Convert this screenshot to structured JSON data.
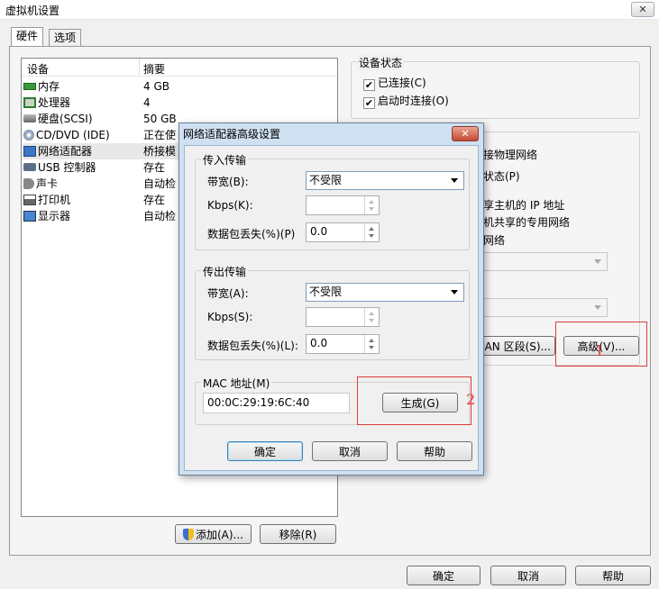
{
  "window": {
    "title": "虚拟机设置",
    "close": "✕"
  },
  "tabs": {
    "hardware": "硬件",
    "options": "选项"
  },
  "device_list": {
    "headers": {
      "device": "设备",
      "summary": "摘要"
    },
    "rows": [
      {
        "device": "内存",
        "summary": "4 GB",
        "icon": "memory-icon"
      },
      {
        "device": "处理器",
        "summary": "4",
        "icon": "processor-icon"
      },
      {
        "device": "硬盘(SCSI)",
        "summary": "50 GB",
        "icon": "hard-disk-icon"
      },
      {
        "device": "CD/DVD (IDE)",
        "summary": "正在使",
        "icon": "cd-dvd-icon"
      },
      {
        "device": "网络适配器",
        "summary": "桥接模",
        "icon": "network-adapter-icon"
      },
      {
        "device": "USB 控制器",
        "summary": "存在",
        "icon": "usb-icon"
      },
      {
        "device": "声卡",
        "summary": "自动检",
        "icon": "sound-card-icon"
      },
      {
        "device": "打印机",
        "summary": "存在",
        "icon": "printer-icon"
      },
      {
        "device": "显示器",
        "summary": "自动检",
        "icon": "display-icon"
      }
    ],
    "add_button": "添加(A)...",
    "remove_button": "移除(R)"
  },
  "device_status": {
    "title": "设备状态",
    "connected": "已连接(C)",
    "connect_at_power_on": "启动时连接(O)"
  },
  "network_conn_partial": {
    "bridged": "接物理网络",
    "replicate": "状态(P)",
    "nat": "享主机的 IP 地址",
    "host_only": "机共享的专用网络",
    "lan": "网络",
    "lan_segments_button": "AN 区段(S)...",
    "advanced_button": "高级(V)..."
  },
  "main_buttons": {
    "ok": "确定",
    "cancel": "取消",
    "help": "帮助"
  },
  "dialog": {
    "title": "网络适配器高级设置",
    "close": "✕",
    "incoming": {
      "title": "传入传输",
      "bandwidth_label": "带宽(B):",
      "bandwidth_value": "不受限",
      "kbps_label": "Kbps(K):",
      "kbps_value": "",
      "loss_label": "数据包丢失(%)(P)",
      "loss_value": "0.0"
    },
    "outgoing": {
      "title": "传出传输",
      "bandwidth_label": "带宽(A):",
      "bandwidth_value": "不受限",
      "kbps_label": "Kbps(S):",
      "kbps_value": "",
      "loss_label": "数据包丢失(%)(L):",
      "loss_value": "0.0"
    },
    "mac": {
      "title": "MAC 地址(M)",
      "value": "00:0C:29:19:6C:40",
      "generate_button": "生成(G)"
    },
    "buttons": {
      "ok": "确定",
      "cancel": "取消",
      "help": "帮助"
    }
  },
  "annotations": {
    "box1": "1",
    "box2": "2"
  },
  "colors": {
    "annotation_red": "#e03a3a",
    "dialog_frame": "#cfe0f1"
  }
}
